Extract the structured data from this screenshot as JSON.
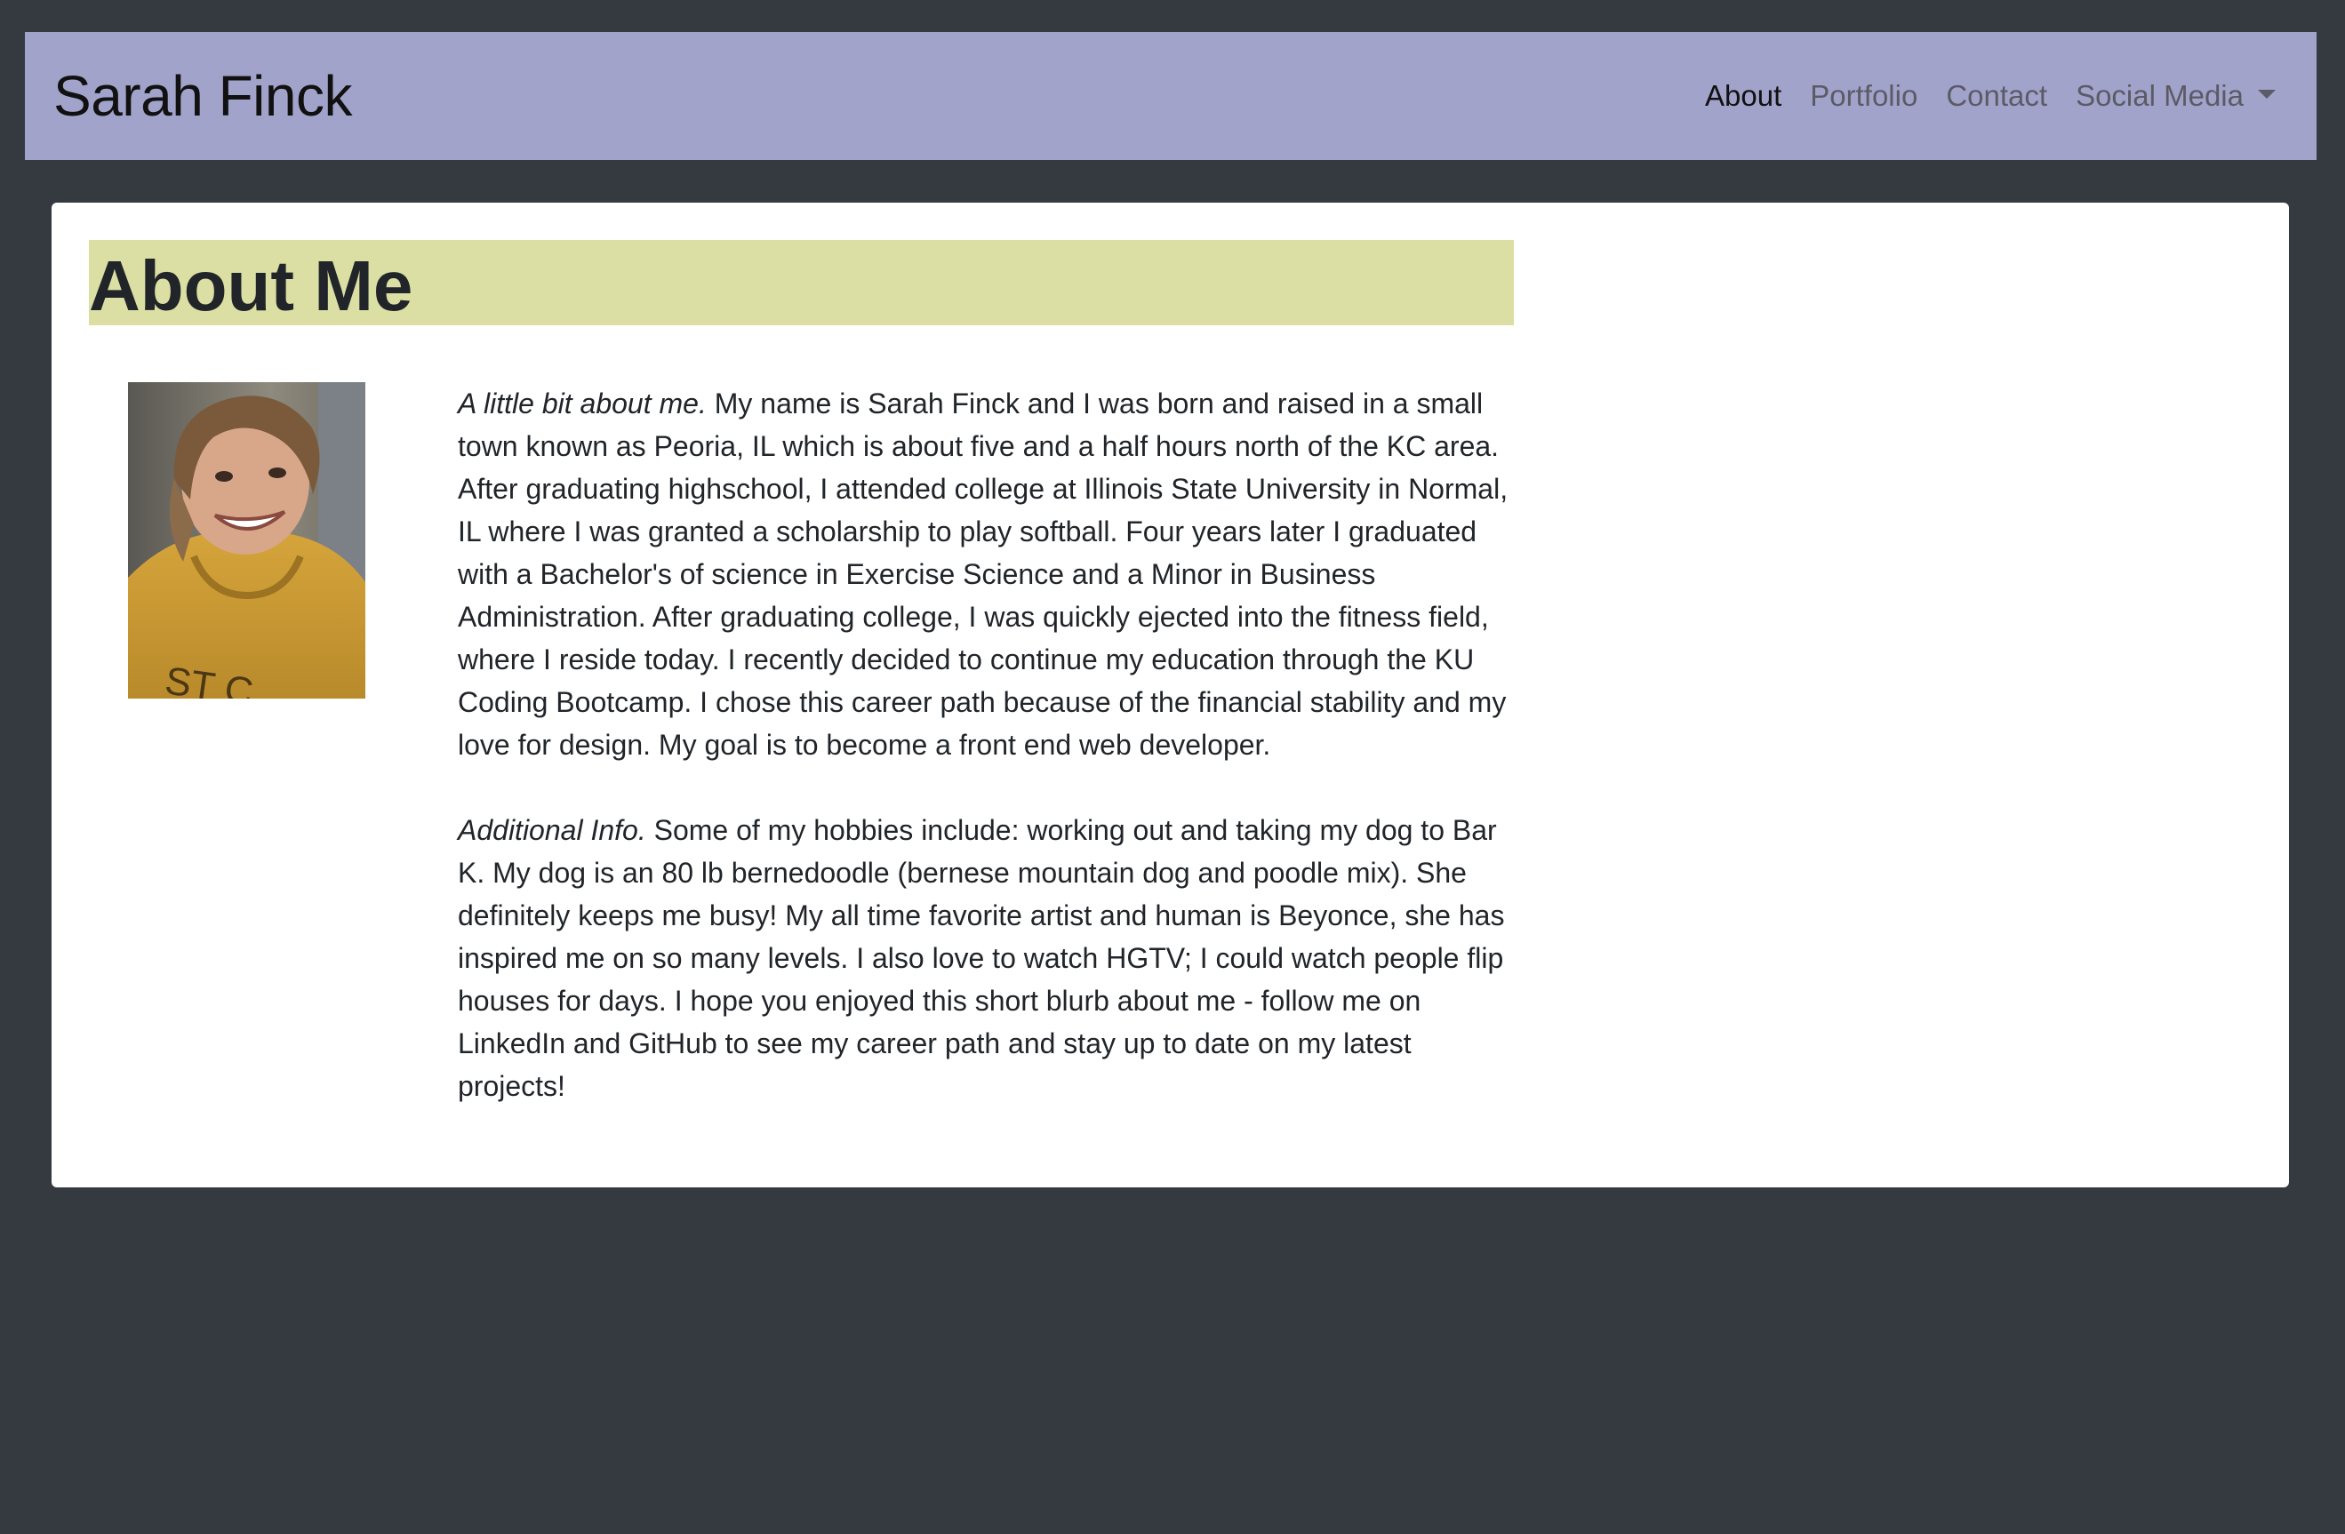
{
  "brand": {
    "name": "Sarah Finck"
  },
  "nav": {
    "items": [
      {
        "label": "About",
        "active": true
      },
      {
        "label": "Portfolio",
        "active": false
      },
      {
        "label": "Contact",
        "active": false
      },
      {
        "label": "Social Media",
        "active": false,
        "dropdown": true
      }
    ]
  },
  "main": {
    "title": "About Me",
    "photo_icon": "profile-photo",
    "paragraphs": [
      {
        "lead": "A little bit about me.",
        "text": " My name is Sarah Finck and I was born and raised in a small town known as Peoria, IL which is about five and a half hours north of the KC area. After graduating highschool, I attended college at Illinois State University in Normal, IL where I was granted a scholarship to play softball. Four years later I graduated with a Bachelor's of science in Exercise Science and a Minor in Business Administration. After graduating college, I was quickly ejected into the fitness field, where I reside today. I recently decided to continue my education through the KU Coding Bootcamp. I chose this career path because of the financial stability and my love for design. My goal is to become a front end web developer."
      },
      {
        "lead": "Additional Info.",
        "text": " Some of my hobbies include: working out and taking my dog to Bar K. My dog is an 80 lb bernedoodle (bernese mountain dog and poodle mix). She definitely keeps me busy! My all time favorite artist and human is Beyonce, she has inspired me on so many levels. I also love to watch HGTV; I could watch people flip houses for days. I hope you enjoyed this short blurb about me - follow me on LinkedIn and GitHub to see my career path and stay up to date on my latest projects!"
      }
    ]
  },
  "colors": {
    "page_bg": "#343a40",
    "navbar_bg": "#a2a3cb",
    "heading_bg": "#dbdfa3",
    "card_bg": "#ffffff"
  }
}
